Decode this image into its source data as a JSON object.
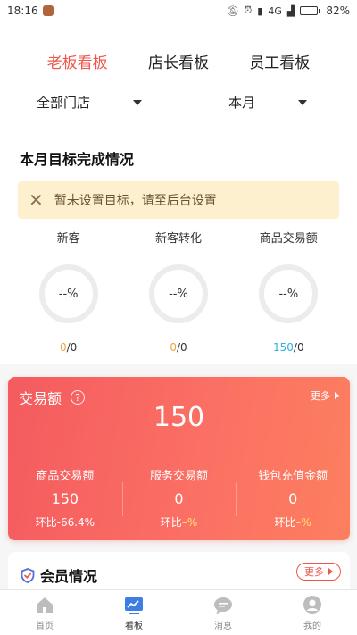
{
  "status_bar": {
    "time": "18:16",
    "network": "4G",
    "battery": "82%",
    "battery_level": 0.82
  },
  "tabs": [
    {
      "label": "老板看板",
      "active": true
    },
    {
      "label": "店长看板",
      "active": false
    },
    {
      "label": "员工看板",
      "active": false
    }
  ],
  "filters": {
    "store": "全部门店",
    "period": "本月"
  },
  "goals": {
    "title": "本月目标完成情况",
    "notice": "暂未设置目标，请至后台设置",
    "metrics": [
      {
        "label": "新客",
        "percent": "--%",
        "done": "0",
        "total": "/0"
      },
      {
        "label": "新客转化",
        "percent": "--%",
        "done": "0",
        "total": "/0"
      },
      {
        "label": "商品交易额",
        "percent": "--%",
        "done": "150",
        "total": "/0"
      }
    ]
  },
  "revenue": {
    "title": "交易额",
    "help": "?",
    "more": "更多",
    "value": "150",
    "columns": [
      {
        "label": "商品交易额",
        "value": "150",
        "compare_prefix": "环比",
        "compare_value": "-66.4%"
      },
      {
        "label": "服务交易额",
        "value": "0",
        "compare_prefix": "环比",
        "compare_value": "–%"
      },
      {
        "label": "钱包充值金额",
        "value": "0",
        "compare_prefix": "环比",
        "compare_value": "–%"
      }
    ]
  },
  "members": {
    "title": "会员情况",
    "more": "更多"
  },
  "bottom_nav": [
    {
      "label": "首页",
      "icon": "home-icon",
      "active": false
    },
    {
      "label": "看板",
      "icon": "dashboard-icon",
      "active": true
    },
    {
      "label": "消息",
      "icon": "message-icon",
      "active": false
    },
    {
      "label": "我的",
      "icon": "profile-icon",
      "active": false
    }
  ],
  "colors": {
    "accent": "#f0554a",
    "card_gradient_start": "#f45b5f",
    "card_gradient_end": "#fd7f5f",
    "active_nav": "#3d7ee6"
  }
}
